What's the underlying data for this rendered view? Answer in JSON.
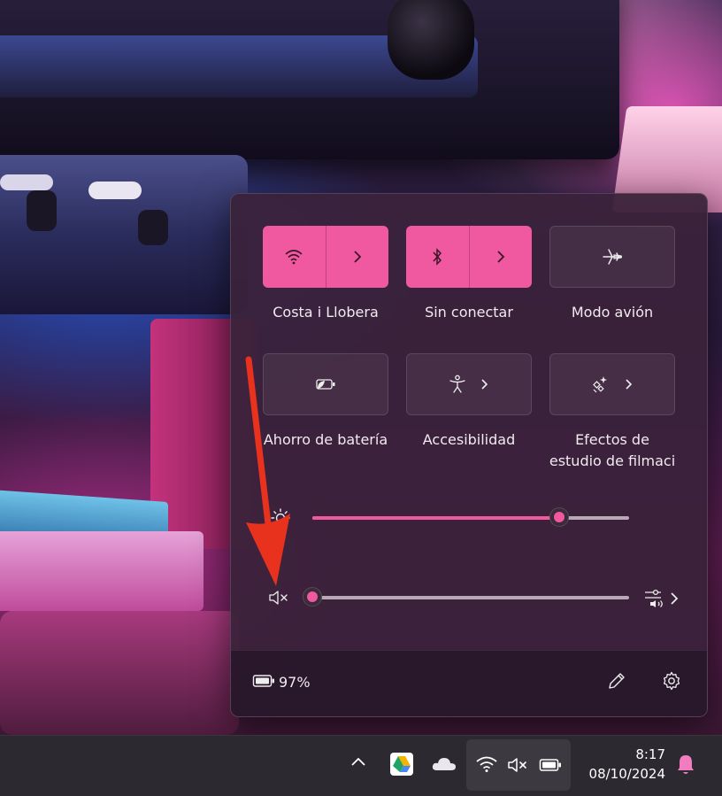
{
  "colors": {
    "accent": "#f0589f",
    "panel": "#3a223a",
    "taskbar": "#2c2a30",
    "annotation": "#e8321e"
  },
  "tiles": [
    {
      "id": "wifi",
      "label": "Costa i Llobera",
      "icon": "wifi-icon",
      "state": "on",
      "has_arrow": true
    },
    {
      "id": "bluetooth",
      "label": "Sin conectar",
      "icon": "bluetooth-icon",
      "state": "on",
      "has_arrow": true
    },
    {
      "id": "airplane",
      "label": "Modo avión",
      "icon": "airplane-icon",
      "state": "off",
      "has_arrow": false
    },
    {
      "id": "battery-saver",
      "label": "Ahorro de batería",
      "icon": "battery-saver-icon",
      "state": "off",
      "has_arrow": false
    },
    {
      "id": "accessibility",
      "label": "Accesibilidad",
      "icon": "accessibility-icon",
      "state": "off",
      "has_arrow": true
    },
    {
      "id": "studio-effects",
      "label_line1": "Efectos de",
      "label_line2": "estudio de filmaci",
      "icon": "sparkle-effects-icon",
      "state": "off",
      "has_arrow": true
    }
  ],
  "brightness": {
    "icon": "sun-icon",
    "level": 0.78
  },
  "volume": {
    "icon": "speaker-muted-icon",
    "level": 0.0,
    "output_icon": "audio-output-icon"
  },
  "footer": {
    "battery_percent": "97%",
    "battery_icon": "battery-icon",
    "edit_icon": "pencil-icon",
    "settings_icon": "gear-icon"
  },
  "taskbar": {
    "overflow_icon": "chevron-up-icon",
    "apps": [
      "google-drive-icon",
      "onedrive-cloud-icon"
    ],
    "status_icons": [
      "wifi-icon",
      "speaker-muted-icon",
      "battery-icon"
    ],
    "time": "8:17",
    "date": "08/10/2024",
    "notification_icon": "bell-icon"
  },
  "annotation": {
    "type": "arrow",
    "points_to": "volume-mute-button"
  }
}
